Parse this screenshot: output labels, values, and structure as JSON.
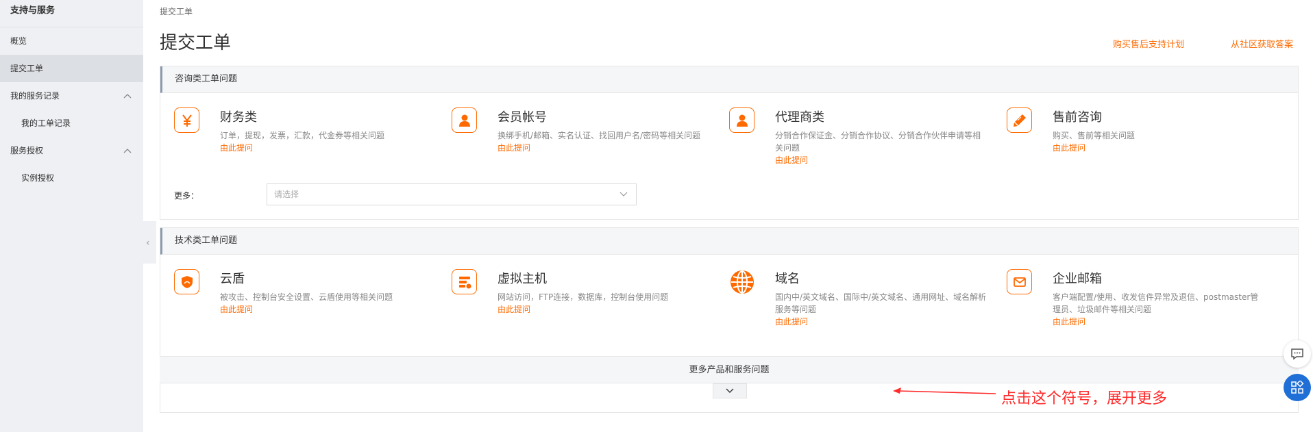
{
  "sidebar": {
    "title": "支持与服务",
    "items": [
      {
        "label": "概览"
      },
      {
        "label": "提交工单"
      },
      {
        "label": "我的服务记录"
      },
      {
        "label": "我的工单记录"
      },
      {
        "label": "服务授权"
      },
      {
        "label": "实例授权"
      }
    ]
  },
  "breadcrumb": "提交工单",
  "page_title": "提交工单",
  "top_links": [
    "购买售后支持计划",
    "从社区获取答案"
  ],
  "consult_section": {
    "title": "咨询类工单问题",
    "categories": [
      {
        "title": "财务类",
        "desc": "订单，提现，发票，汇款，代金券等相关问题",
        "link": "由此提问",
        "icon": "yen-icon"
      },
      {
        "title": "会员帐号",
        "desc": "换绑手机/邮箱、实名认证、找回用户名/密码等相关问题",
        "link": "由此提问",
        "icon": "user-icon"
      },
      {
        "title": "代理商类",
        "desc": "分销合作保证金、分销合作协议、分销合作伙伴申请等相关问题",
        "link": "由此提问",
        "icon": "user-icon"
      },
      {
        "title": "售前咨询",
        "desc": "购买、售前等相关问题",
        "link": "由此提问",
        "icon": "pencil-icon"
      }
    ],
    "more_label": "更多：",
    "select_placeholder": "请选择"
  },
  "tech_section": {
    "title": "技术类工单问题",
    "categories": [
      {
        "title": "云盾",
        "desc": "被攻击、控制台安全设置、云盾使用等相关问题",
        "link": "由此提问",
        "icon": "shield-icon"
      },
      {
        "title": "虚拟主机",
        "desc": "网站访问，FTP连接，数据库，控制台使用问题",
        "link": "由此提问",
        "icon": "server-icon"
      },
      {
        "title": "域名",
        "desc": "国内中/英文域名、国际中/英文域名、通用网址、域名解析服务等问题",
        "link": "由此提问",
        "icon": "globe-icon"
      },
      {
        "title": "企业邮箱",
        "desc": "客户端配置/使用、收发信件异常及退信、postmaster管理员、垃圾邮件等相关问题",
        "link": "由此提问",
        "icon": "mail-icon"
      }
    ],
    "more_bar": "更多产品和服务问题"
  },
  "annotation": "点击这个符号，展开更多",
  "colors": {
    "accent": "#ff6a00",
    "annotation": "#ff2a2a",
    "float_blue": "#1f6fd6"
  }
}
